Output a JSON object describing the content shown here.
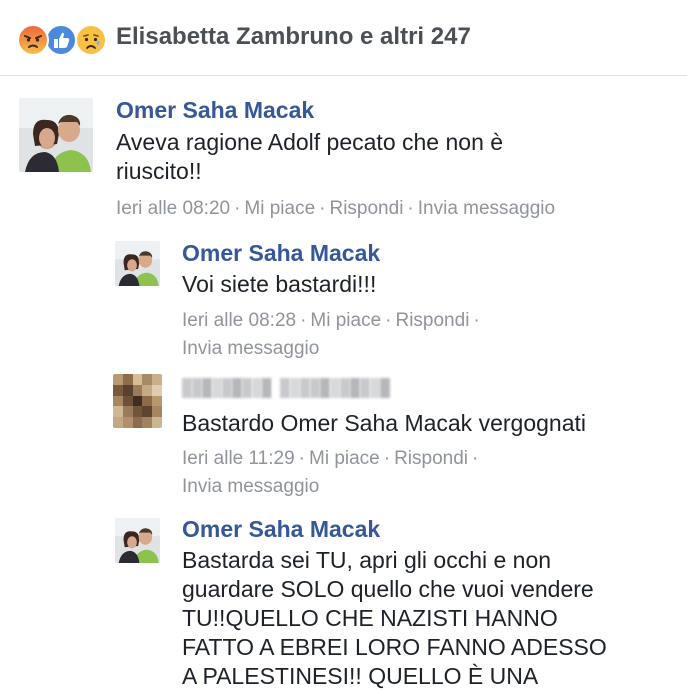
{
  "header": {
    "reactions": [
      {
        "icon": "angry-reaction-icon",
        "color": "#f0653b"
      },
      {
        "icon": "like-reaction-icon",
        "color": "#4a89dc"
      },
      {
        "icon": "sad-reaction-icon",
        "color": "#f7c145"
      }
    ],
    "text": "Elisabetta Zambruno e altri 247"
  },
  "comments": [
    {
      "author": "Omer Saha Macak",
      "text_lines": [
        "Aveva ragione Adolf pecato che non è",
        "riuscito!!"
      ],
      "time": "Ieri alle 08:20",
      "like": "Mi piace",
      "reply": "Rispondi",
      "message": "Invia messaggio"
    },
    {
      "author": "Omer Saha Macak",
      "text_lines": [
        "Voi siete bastardi!!!"
      ],
      "time": "Ieri alle 08:28",
      "like": "Mi piace",
      "reply": "Rispondi",
      "message": "Invia messaggio"
    },
    {
      "author": "",
      "text_lines": [
        "Bastardo Omer Saha Macak vergognati"
      ],
      "time": "Ieri alle 11:29",
      "like": "Mi piace",
      "reply": "Rispondi",
      "message": "Invia messaggio"
    },
    {
      "author": "Omer Saha Macak",
      "text_lines": [
        "Bastarda sei TU, apri gli occhi e non",
        "guardare SOLO quello che vuoi vendere",
        "TU!!QUELLO CHE NAZISTI HANNO",
        "FATTO A EBREI LORO FANNO ADESSO",
        "A PALESTINESI!! QUELLO È UNA"
      ]
    }
  ],
  "separator": "·",
  "colors": {
    "author": "#365899",
    "meta": "#90949c",
    "text": "#1d2129",
    "header_text": "#4b4f56"
  }
}
